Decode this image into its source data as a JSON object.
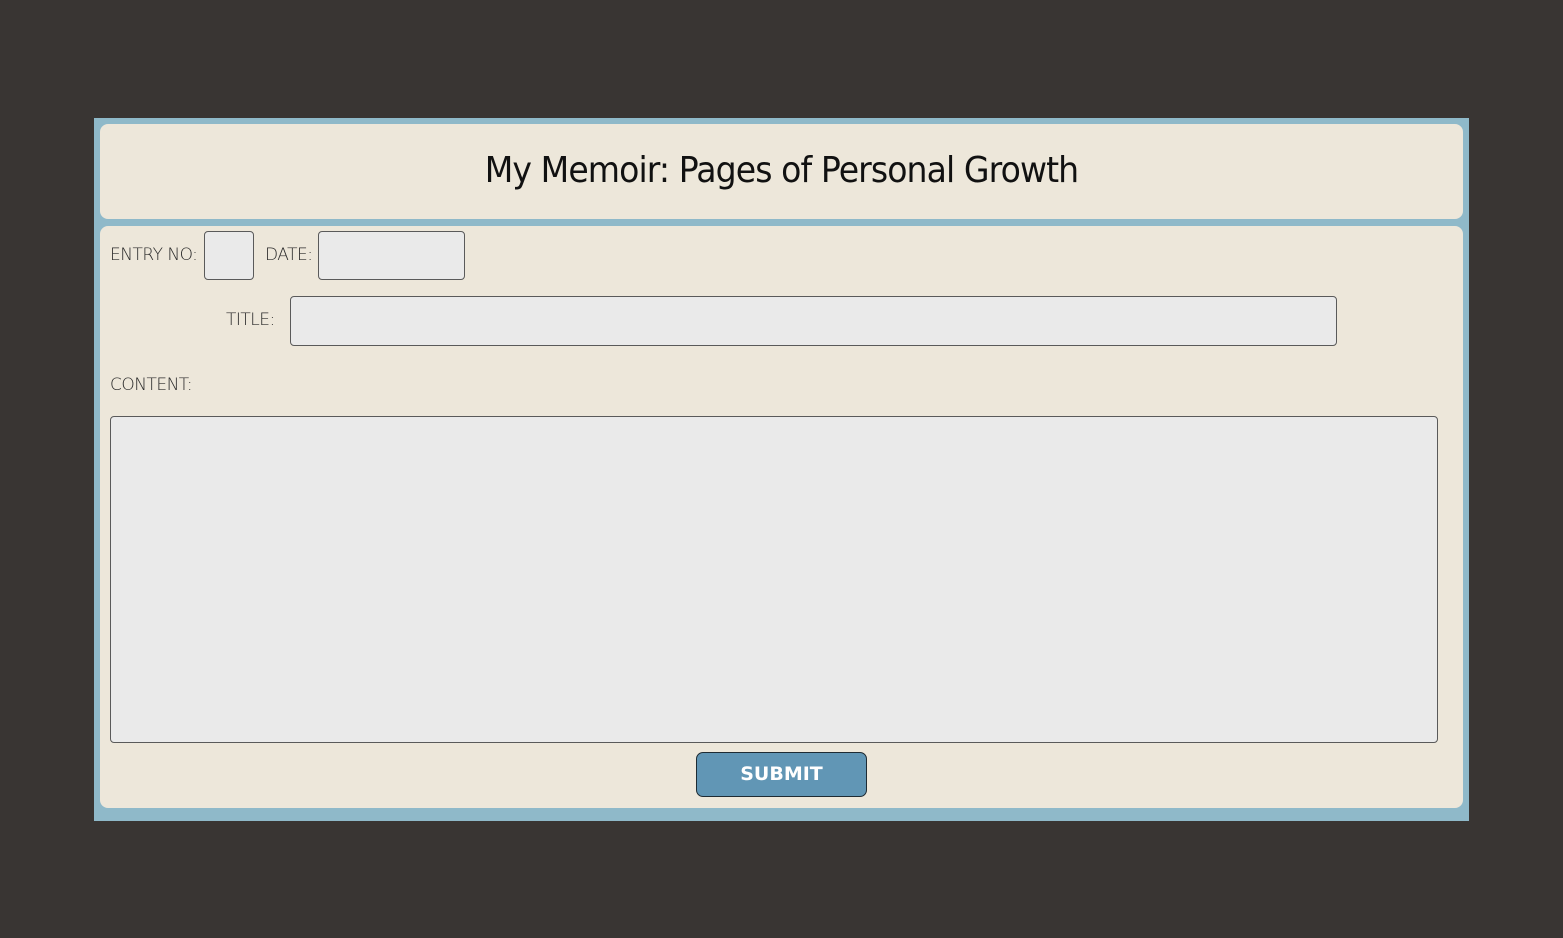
{
  "header": {
    "title": "My Memoir: Pages of Personal Growth"
  },
  "form": {
    "entry_no_label": "ENTRY NO:",
    "entry_no_value": "",
    "date_label": "DATE:",
    "date_value": "",
    "title_label": "TITLE:",
    "title_value": "",
    "content_label": "CONTENT:",
    "content_value": "",
    "submit_label": "SUBMIT"
  },
  "colors": {
    "background": "#393533",
    "frame": "#8fb9c9",
    "card": "#ede7da",
    "field": "#eaeaea",
    "submit": "#6196b5"
  }
}
